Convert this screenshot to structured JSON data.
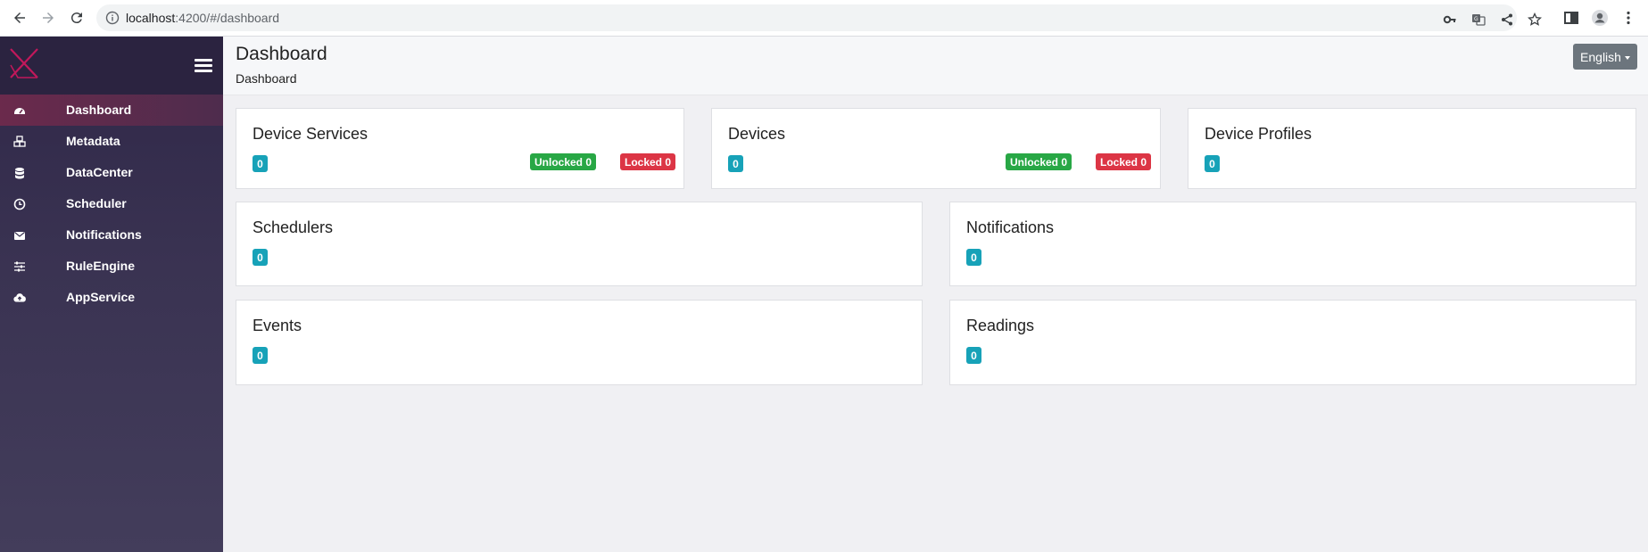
{
  "browser": {
    "url_host": "localhost",
    "url_rest": ":4200/#/dashboard"
  },
  "sidebar": {
    "items": [
      {
        "label": "Dashboard",
        "icon": "dashboard-icon",
        "active": true
      },
      {
        "label": "Metadata",
        "icon": "cubes-icon",
        "active": false
      },
      {
        "label": "DataCenter",
        "icon": "database-icon",
        "active": false
      },
      {
        "label": "Scheduler",
        "icon": "clock-icon",
        "active": false
      },
      {
        "label": "Notifications",
        "icon": "envelope-icon",
        "active": false
      },
      {
        "label": "RuleEngine",
        "icon": "sliders-icon",
        "active": false
      },
      {
        "label": "AppService",
        "icon": "cloud-upload-icon",
        "active": false
      }
    ]
  },
  "header": {
    "title": "Dashboard",
    "breadcrumb": "Dashboard",
    "language": "English"
  },
  "cards": {
    "device_services": {
      "title": "Device Services",
      "count": "0",
      "unlocked": "Unlocked 0",
      "locked": "Locked 0"
    },
    "devices": {
      "title": "Devices",
      "count": "0",
      "unlocked": "Unlocked 0",
      "locked": "Locked 0"
    },
    "device_profiles": {
      "title": "Device Profiles",
      "count": "0"
    },
    "schedulers": {
      "title": "Schedulers",
      "count": "0"
    },
    "notifications": {
      "title": "Notifications",
      "count": "0"
    },
    "events": {
      "title": "Events",
      "count": "0"
    },
    "readings": {
      "title": "Readings",
      "count": "0"
    }
  },
  "colors": {
    "sidebar_bg": "#2f2748",
    "active_item": "#6b2a4c",
    "count_badge": "#17a2b8",
    "unlocked_badge": "#28a745",
    "locked_badge": "#dc3545",
    "language_button": "#6c757d"
  }
}
